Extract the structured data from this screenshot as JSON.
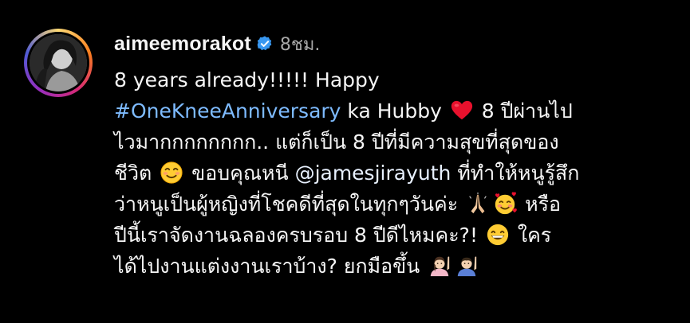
{
  "comment": {
    "username": "aimeemorakot",
    "timestamp": "8ชม.",
    "lines": {
      "l1": "8 years already!!!!! Happy",
      "l2_hashtag": "#OneKneeAnniversary",
      "l2_text": " ka Hubby ",
      "l2_after": " 8 ปีผ่านไป",
      "l3": "ไวมากกกกกกกก.. แต่ก็เป็น 8 ปีที่มีความสุขที่สุดของ",
      "l4_before": "ชีวิต ",
      "l4_mid": " ขอบคุณหนี ",
      "l4_mention": "@jamesjirayuth",
      "l4_after": " ที่ทำให้หนูรู้สึก",
      "l5_text": "ว่าหนูเป็นผู้หญิงที่โชคดีที่สุดในทุกๆวันค่ะ ",
      "l5_after": " หรือ",
      "l6_text": "ปีนี้เราจัดงานฉลองครบรอบ 8 ปีดีไหมคะ?! ",
      "l6_after": " ใคร",
      "l7_text": "ได้ไปงานแต่งงานเราบ้าง? ยกมือขึ้น "
    }
  },
  "colors": {
    "background": "#000000",
    "text": "#f5f5f5",
    "timestamp": "#a8a8a8",
    "hashtag": "#7ebbff",
    "verified": "#3897f0"
  },
  "icons": {
    "verified": "verified-badge-icon",
    "heart": "red-heart-emoji",
    "smile": "smiling-face-emoji",
    "pray": "folded-hands-emoji",
    "love": "smiling-face-with-hearts-emoji",
    "grin": "grinning-face-emoji",
    "raise_woman": "woman-raising-hand-emoji",
    "raise_man": "man-raising-hand-emoji"
  }
}
